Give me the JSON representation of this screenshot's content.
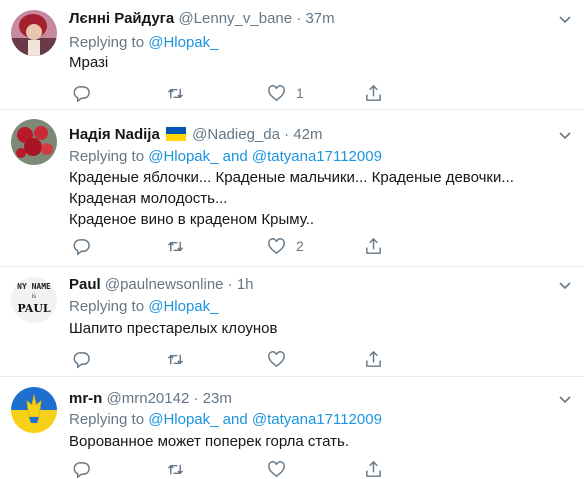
{
  "tweets": [
    {
      "name": "Лєнні Райдуга",
      "handle": "@Lenny_v_bane",
      "time": "37m",
      "reply_prefix": "Replying to",
      "reply_to": "@Hlopak_",
      "reply_and": "",
      "reply_to2": "",
      "lines": [
        "Мразі"
      ],
      "replies": "",
      "retweets": "",
      "likes": "1",
      "has_flag": false,
      "avatar": "avatar-red-hair-portrait"
    },
    {
      "name": "Надія Nadija",
      "handle": "@Nadieg_da",
      "time": "42m",
      "reply_prefix": "Replying to",
      "reply_to": "@Hlopak_",
      "reply_and": "and",
      "reply_to2": "@tatyana17112009",
      "lines": [
        "Краденые яблочки... Краденые мальчики... Краденые девочки...",
        "Краденая молодость...",
        "Краденое вино в краденом Крыму.."
      ],
      "replies": "",
      "retweets": "",
      "likes": "2",
      "has_flag": true,
      "avatar": "avatar-red-roses"
    },
    {
      "name": "Paul",
      "handle": "@paulnewsonline",
      "time": "1h",
      "reply_prefix": "Replying to",
      "reply_to": "@Hlopak_",
      "reply_and": "",
      "reply_to2": "",
      "lines": [
        "Шапито престарелых клоунов"
      ],
      "replies": "",
      "retweets": "",
      "likes": "",
      "has_flag": false,
      "avatar": "avatar-handwritten-name-paul"
    },
    {
      "name": "mr-n",
      "handle": "@mrn20142",
      "time": "23m",
      "reply_prefix": "Replying to",
      "reply_to": "@Hlopak_",
      "reply_and": "and",
      "reply_to2": "@tatyana17112009",
      "lines": [
        "Ворованное может поперек горла стать."
      ],
      "replies": "",
      "retweets": "",
      "likes": "",
      "has_flag": false,
      "avatar": "avatar-ukraine-trident"
    }
  ],
  "avatar_paul_text": [
    "NY NAME",
    "is",
    "PAUL"
  ],
  "separator": "·",
  "colors": {
    "link": "#1b95e0",
    "secondary": "#657786",
    "divider": "#e6ecf0",
    "flag_blue": "#0057b7",
    "flag_yellow": "#ffd700"
  },
  "icons": [
    "reply-icon",
    "retweet-icon",
    "like-icon",
    "share-icon",
    "chevron-down-icon"
  ]
}
